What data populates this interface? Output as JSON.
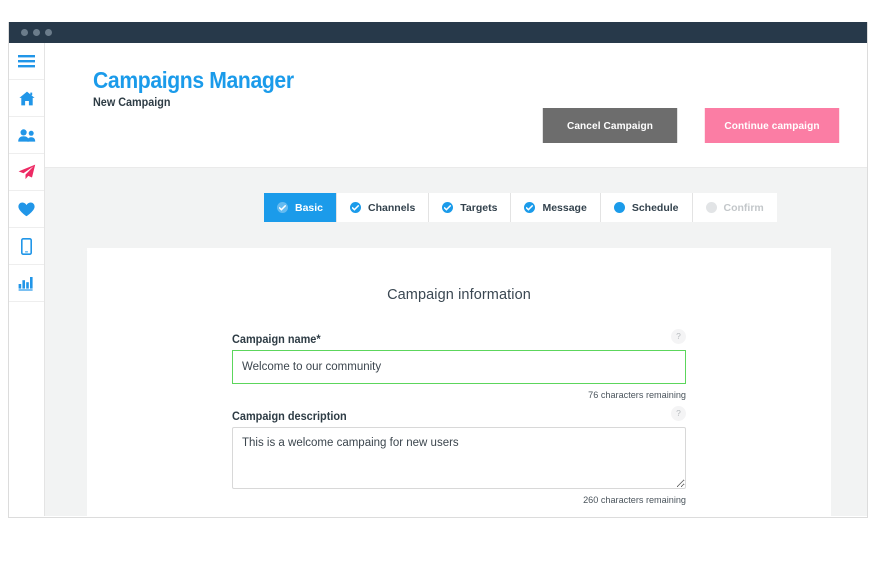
{
  "window": {
    "titlebar_dots": 3
  },
  "sidebar": {
    "items": [
      {
        "icon": "hamburger-menu-icon",
        "name": "menu-toggle",
        "color": "#2196e8"
      },
      {
        "icon": "home-icon",
        "name": "sidebar-item-home",
        "color": "#2196e8"
      },
      {
        "icon": "users-icon",
        "name": "sidebar-item-contacts",
        "color": "#2196e8"
      },
      {
        "icon": "paper-plane-icon",
        "name": "sidebar-item-campaigns",
        "color": "#ed2a64"
      },
      {
        "icon": "heart-icon",
        "name": "sidebar-item-engagement",
        "color": "#2196e8"
      },
      {
        "icon": "mobile-phone-icon",
        "name": "sidebar-item-mobile",
        "color": "#2196e8"
      },
      {
        "icon": "bar-chart-icon",
        "name": "sidebar-item-reports",
        "color": "#2196e8"
      }
    ]
  },
  "header": {
    "title": "Campaigns Manager",
    "subtitle": "New Campaign",
    "title_color": "#1b9bea",
    "cancel_label": "Cancel Campaign",
    "continue_label": "Continue campaign",
    "cancel_color": "#6d6d6d",
    "continue_color": "#fb7da4"
  },
  "steps": [
    {
      "label": "Basic",
      "state": "active",
      "icon": "check-circle-icon"
    },
    {
      "label": "Channels",
      "state": "complete",
      "icon": "check-circle-icon"
    },
    {
      "label": "Targets",
      "state": "complete",
      "icon": "check-circle-icon"
    },
    {
      "label": "Message",
      "state": "complete",
      "icon": "check-circle-icon"
    },
    {
      "label": "Schedule",
      "state": "pending",
      "icon": "circle-icon"
    },
    {
      "label": "Confirm",
      "state": "disabled",
      "icon": "circle-icon"
    }
  ],
  "form": {
    "section_title": "Campaign information",
    "help_glyph": "?",
    "name_field": {
      "label": "Campaign name*",
      "value": "Welcome to our community",
      "placeholder": "",
      "counter": "76 characters remaining",
      "border_color": "#5cd65c"
    },
    "description_field": {
      "label": "Campaign description",
      "value": "This is a welcome campaing for new users",
      "placeholder": "",
      "counter": "260 characters remaining",
      "border_color": "#d8d8d8"
    }
  }
}
